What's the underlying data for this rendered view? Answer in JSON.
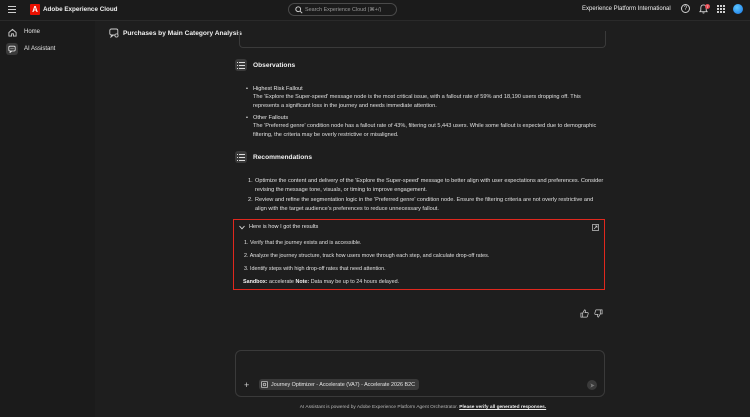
{
  "topbar": {
    "app_title": "Adobe Experience Cloud",
    "logo_letter": "A",
    "search_placeholder": "Search Experience Cloud (⌘+/)",
    "org_name": "Experience Platform International",
    "notification_count": "7",
    "help_glyph": "?"
  },
  "sidebar": {
    "items": [
      {
        "label": "Home",
        "icon": "home-icon"
      },
      {
        "label": "AI Assistant",
        "icon": "ai-assistant-icon"
      }
    ]
  },
  "header": {
    "title": "Purchases by Main Category Analysis"
  },
  "observations": {
    "title": "Observations",
    "items": [
      {
        "head": "Highest Risk Fallout",
        "body": "The 'Explore the Super-speed' message node is the most critical issue, with a fallout rate of 59% and 18,190 users dropping off. This represents a significant loss in the journey and needs immediate attention."
      },
      {
        "head": "Other Fallouts",
        "body": "The 'Preferred genre' condition node has a fallout rate of 43%, filtering out 5,443 users. While some fallout is expected due to demographic filtering, the criteria may be overly restrictive or misaligned."
      }
    ]
  },
  "recommendations": {
    "title": "Recommendations",
    "items": [
      {
        "num": "1.",
        "text": "Optimize the content and delivery of the 'Explore the Super-speed' message to better align with user expectations and preferences. Consider revising the message tone, visuals, or timing to improve engagement."
      },
      {
        "num": "2.",
        "text": "Review and refine the segmentation logic in the 'Preferred genre' condition node. Ensure the filtering criteria are not overly restrictive and align with the target audience's preferences to reduce unnecessary fallout."
      }
    ]
  },
  "how": {
    "title": "Here is how I got the results",
    "steps": [
      "1. Verify that the journey exists and is accessible.",
      "2. Analyze the journey structure, track how users move through each step, and calculate drop-off rates.",
      "3. Identify steps with high drop-off rates that need attention."
    ],
    "sandbox_label": "Sandbox:",
    "sandbox_value": " accelerate ",
    "note_label": "Note:",
    "note_value": " Data may be up to 24 hours delayed."
  },
  "composer": {
    "plus": "+",
    "context_chip": "Journey Optimizer - Accelerate (VA7) - Accelerate 2026 B2C"
  },
  "footer": {
    "text": "AI Assistant is powered by Adobe Experience Platform Agent Orchestrator. ",
    "link": "Please verify all generated responses."
  },
  "colors": {
    "highlight_border": "#e0281e",
    "adobe_red": "#eb1000",
    "background": "#1e1e1e"
  }
}
